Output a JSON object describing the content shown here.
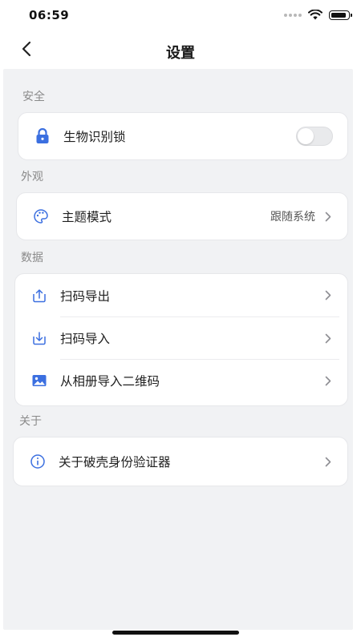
{
  "status_bar": {
    "time": "06:59"
  },
  "nav": {
    "title": "设置",
    "back_icon": "chevron-left-icon"
  },
  "colors": {
    "accent": "#3b6fe0",
    "background": "#f1f2f4",
    "card": "#ffffff"
  },
  "sections": {
    "security": {
      "header": "安全",
      "biometric_lock": {
        "label": "生物识别锁",
        "icon": "lock-icon",
        "enabled": false
      }
    },
    "appearance": {
      "header": "外观",
      "theme_mode": {
        "label": "主题模式",
        "value": "跟随系统",
        "icon": "palette-icon"
      }
    },
    "data": {
      "header": "数据",
      "items": [
        {
          "label": "扫码导出",
          "icon": "upload-icon"
        },
        {
          "label": "扫码导入",
          "icon": "download-icon"
        },
        {
          "label": "从相册导入二维码",
          "icon": "image-icon"
        }
      ]
    },
    "about": {
      "header": "关于",
      "about_item": {
        "label": "关于破壳身份验证器",
        "icon": "info-icon"
      }
    }
  }
}
